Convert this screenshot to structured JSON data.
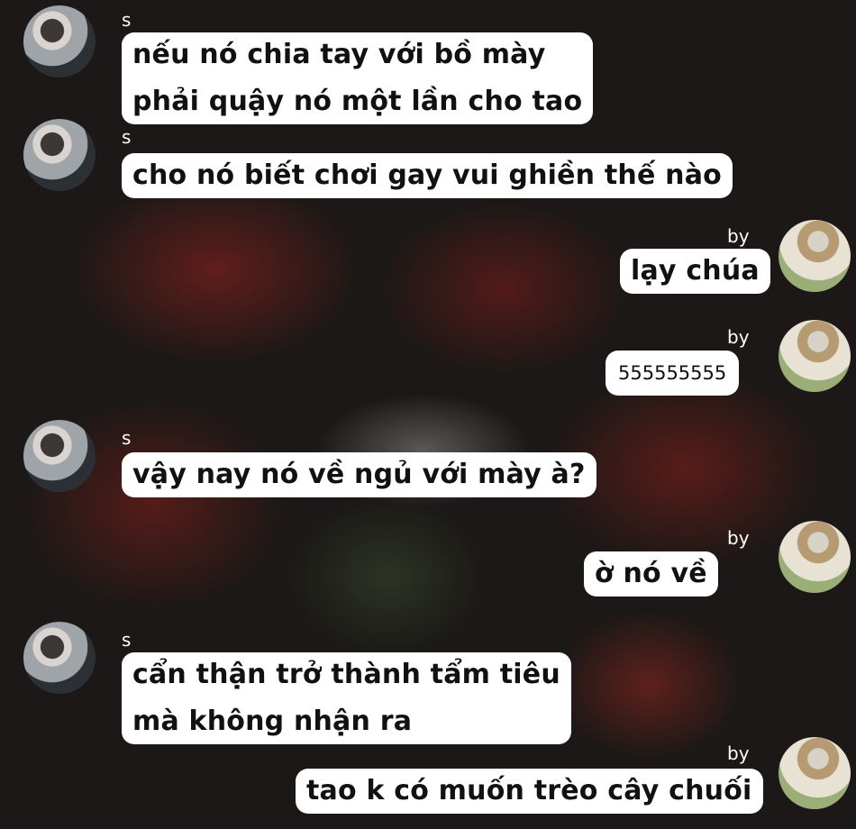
{
  "chat": {
    "messages": [
      {
        "sender": "s",
        "side": "left",
        "lines": [
          "nếu nó chia tay với bồ mày",
          "phải quậy nó một lần cho tao"
        ]
      },
      {
        "sender": "s",
        "side": "left",
        "lines": [
          "cho nó biết chơi gay vui ghiền thế nào"
        ]
      },
      {
        "sender": "by",
        "side": "right",
        "lines": [
          "lạy chúa"
        ]
      },
      {
        "sender": "by",
        "side": "right",
        "lines": [
          "555555555"
        ]
      },
      {
        "sender": "s",
        "side": "left",
        "lines": [
          "vậy nay nó về ngủ với mày à?"
        ]
      },
      {
        "sender": "by",
        "side": "right",
        "lines": [
          "ờ nó về"
        ]
      },
      {
        "sender": "s",
        "side": "left",
        "lines": [
          "cẩn thận trở thành tẩm tiêu",
          "mà không nhận ra"
        ]
      },
      {
        "sender": "by",
        "side": "right",
        "lines": [
          "tao k có muốn trèo cây chuối"
        ]
      }
    ]
  },
  "colors": {
    "bubble": "#ffffff",
    "text": "#111111",
    "name": "#ffffff",
    "background": "#1b1817"
  }
}
